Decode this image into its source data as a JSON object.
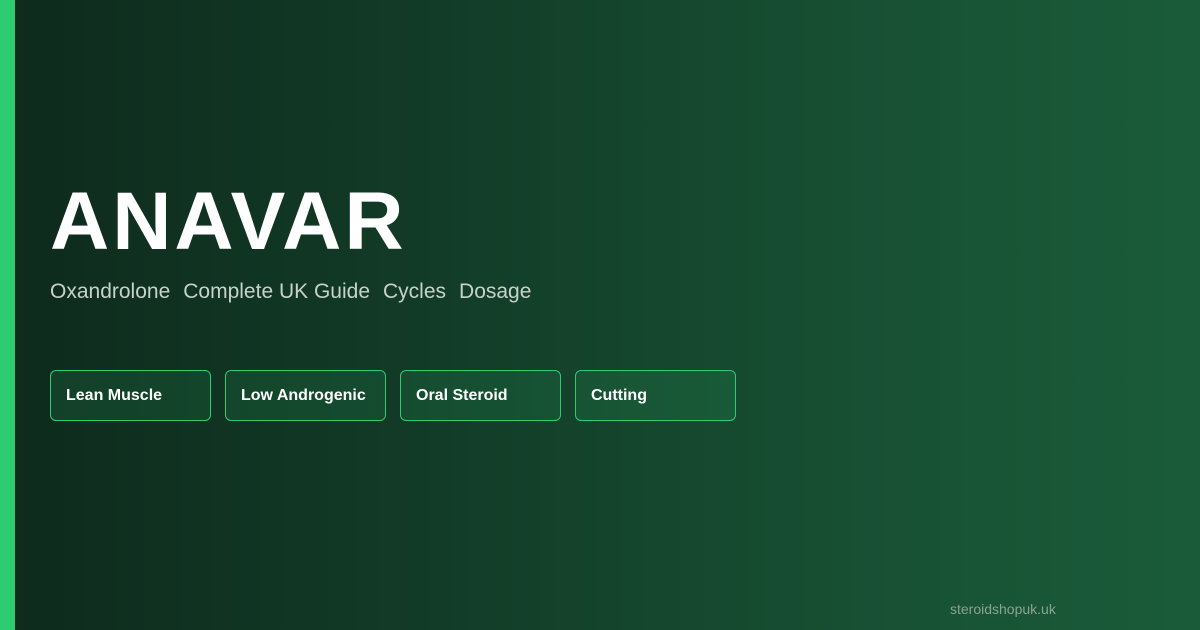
{
  "colors": {
    "accent": "#2ecc71",
    "background_start": "#0e2a1c",
    "background_end": "#1a5c3a",
    "title": "#ffffff",
    "subtitle": "#c6d3cb",
    "footer": "#8aa394"
  },
  "title": "ANAVAR",
  "subtitle": {
    "parts": [
      "Oxandrolone",
      "Complete UK Guide",
      "Cycles",
      "Dosage"
    ]
  },
  "tags": [
    {
      "label": "Lean Muscle"
    },
    {
      "label": "Low Androgenic"
    },
    {
      "label": "Oral Steroid"
    },
    {
      "label": "Cutting"
    }
  ],
  "footer": {
    "domain": "steroidshopuk.uk"
  }
}
